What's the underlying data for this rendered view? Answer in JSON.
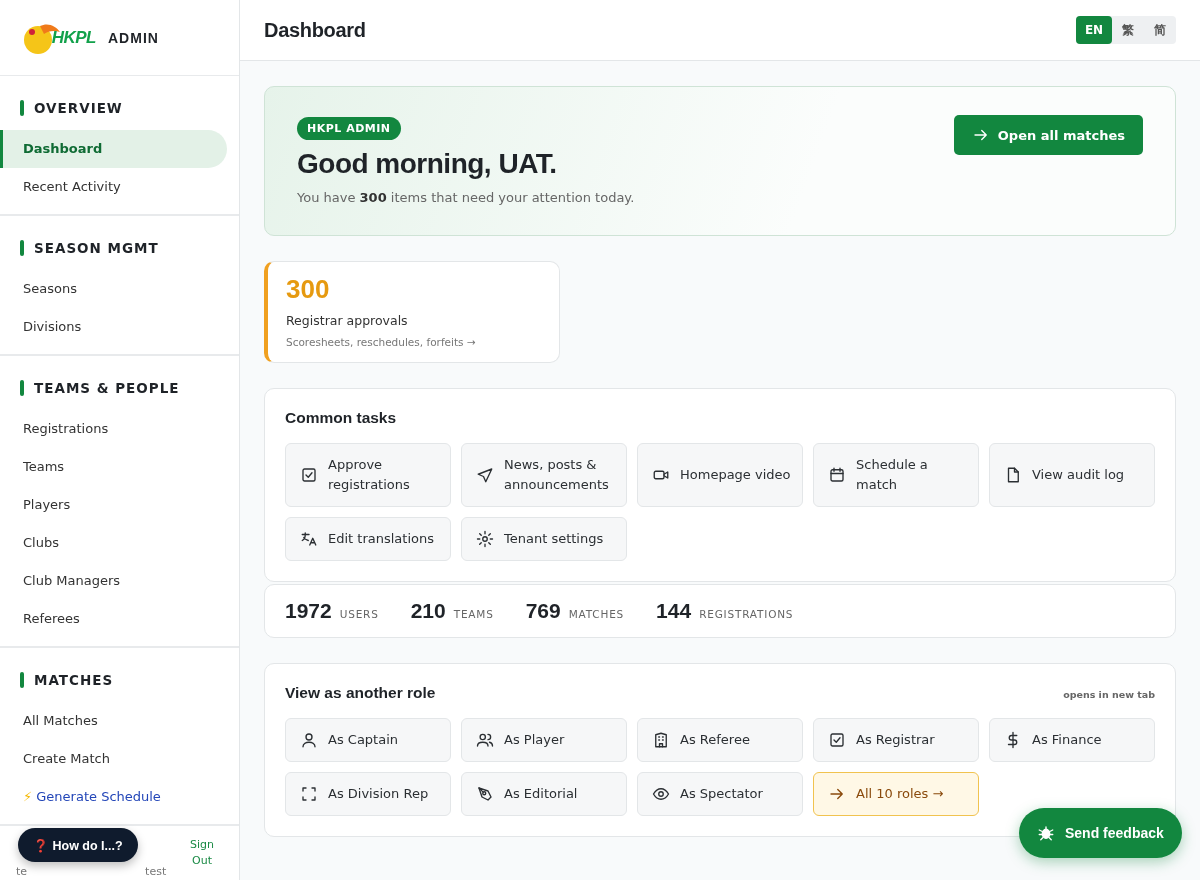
{
  "sidebar": {
    "logo_text": "HKPL",
    "role_label": "ADMIN",
    "sections": [
      {
        "title": "OVERVIEW",
        "items": [
          {
            "label": "Dashboard",
            "selected": true
          },
          {
            "label": "Recent Activity",
            "selected": false
          }
        ]
      },
      {
        "title": "SEASON MGMT",
        "items": [
          {
            "label": "Seasons",
            "selected": false
          },
          {
            "label": "Divisions",
            "selected": false
          }
        ]
      },
      {
        "title": "TEAMS & PEOPLE",
        "items": [
          {
            "label": "Registrations",
            "selected": false
          },
          {
            "label": "Teams",
            "selected": false
          },
          {
            "label": "Players",
            "selected": false
          },
          {
            "label": "Clubs",
            "selected": false
          },
          {
            "label": "Club Managers",
            "selected": false
          },
          {
            "label": "Referees",
            "selected": false
          }
        ]
      },
      {
        "title": "MATCHES",
        "items": [
          {
            "label": "All Matches",
            "selected": false
          },
          {
            "label": "Create Match",
            "selected": false
          },
          {
            "label": "Generate Schedule",
            "selected": false,
            "kind": "action",
            "icon": "⚡"
          }
        ]
      }
    ],
    "footer": {
      "user_visible_start": "te",
      "user_visible_end": "test",
      "sign_out": "Sign Out"
    }
  },
  "header": {
    "title": "Dashboard",
    "languages": [
      {
        "label": "EN",
        "selected": true
      },
      {
        "label": "繁",
        "selected": false
      },
      {
        "label": "简",
        "selected": false
      }
    ]
  },
  "hero": {
    "badge": "HKPL ADMIN",
    "greeting": "Good morning, UAT.",
    "subtitle": "You have **300** items that need your attention today.",
    "button": "Open all matches"
  },
  "attention_cards": [
    {
      "count": "300",
      "title": "Registrar approvals",
      "detail": "Scoresheets, reschedules, forfeits →"
    }
  ],
  "common_tasks": {
    "title": "Common tasks",
    "tasks": [
      "Approve registrations",
      "News, posts & announcements",
      "Homepage video",
      "Schedule a match",
      "View audit log",
      "Edit translations",
      "Tenant settings"
    ]
  },
  "stats": [
    {
      "value": "1972",
      "label": "USERS"
    },
    {
      "value": "210",
      "label": "TEAMS"
    },
    {
      "value": "769",
      "label": "MATCHES"
    },
    {
      "value": "144",
      "label": "REGISTRATIONS"
    }
  ],
  "roles": {
    "title": "View as another role",
    "note": "opens in new tab",
    "items": [
      {
        "label": "As Captain",
        "kind": "role"
      },
      {
        "label": "As Player",
        "kind": "role"
      },
      {
        "label": "As Referee",
        "kind": "role"
      },
      {
        "label": "As Registrar",
        "kind": "role"
      },
      {
        "label": "As Finance",
        "kind": "role"
      },
      {
        "label": "As Division Rep",
        "kind": "role"
      },
      {
        "label": "As Editorial",
        "kind": "role"
      },
      {
        "label": "As Spectator",
        "kind": "role"
      },
      {
        "label": "All 10 roles →",
        "kind": "all"
      }
    ]
  },
  "help_button": "❓ How do I...?",
  "feedback_button": "Send feedback"
}
